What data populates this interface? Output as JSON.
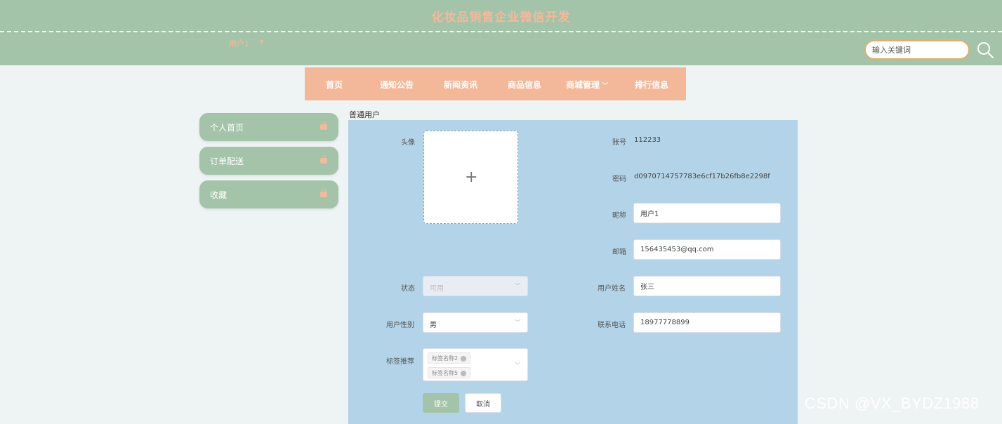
{
  "header": {
    "site_title": "化妆品销售企业微信开发",
    "user_name": "用户1",
    "user_caret": "▾",
    "search_placeholder": "输入关键词"
  },
  "nav": {
    "items": [
      {
        "label": "首页"
      },
      {
        "label": "通知公告"
      },
      {
        "label": "新闻资讯"
      },
      {
        "label": "商品信息"
      },
      {
        "label": "商城管理"
      },
      {
        "label": "排行信息"
      }
    ]
  },
  "sidebar": {
    "items": [
      {
        "label": "个人首页"
      },
      {
        "label": "订单配送"
      },
      {
        "label": "收藏"
      }
    ]
  },
  "form": {
    "title": "普通用户",
    "avatar_label": "头像",
    "account_label": "账号",
    "account_value": "112233",
    "password_label": "密码",
    "password_value": "d0970714757783e6cf17b26fb8e2298f",
    "nickname_label": "昵称",
    "nickname_value": "用户1",
    "email_label": "邮箱",
    "email_value": "156435453@qq.com",
    "status_label": "状态",
    "status_value": "可用",
    "realname_label": "用户姓名",
    "realname_value": "张三",
    "gender_label": "用户性别",
    "gender_value": "男",
    "phone_label": "联系电话",
    "phone_value": "18977778899",
    "tags_label": "标签推荐",
    "tags": [
      "标签名称2",
      "标签名称5"
    ],
    "submit_label": "提交",
    "cancel_label": "取消"
  },
  "watermark": "CSDN @VX_BYDZ1988",
  "colors": {
    "header_bg": "#a3c4a8",
    "accent_peach": "#f2b898",
    "panel_bg": "#b3d4e8",
    "search_border": "#e4ad6b"
  }
}
